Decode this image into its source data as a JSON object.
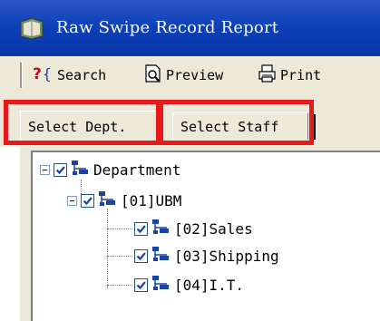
{
  "window": {
    "title": "Raw Swipe Record Report",
    "icon": "report-book-icon"
  },
  "toolbar": {
    "search_label": "Search",
    "preview_label": "Preview",
    "print_label": "Print"
  },
  "tabs": [
    {
      "label": "Select Dept.",
      "active": true
    },
    {
      "label": "Select Staff",
      "active": false
    }
  ],
  "highlight_color": "#e8191c",
  "tree": {
    "root": {
      "label": "Department",
      "checked": true,
      "expanded": true
    },
    "nodes": [
      {
        "label": "[01]UBM",
        "checked": true,
        "expanded": true,
        "level": 1
      },
      {
        "label": "[02]Sales",
        "checked": true,
        "level": 2
      },
      {
        "label": "[03]Shipping",
        "checked": true,
        "level": 2
      },
      {
        "label": "[04]I.T.",
        "checked": true,
        "level": 2
      }
    ]
  }
}
